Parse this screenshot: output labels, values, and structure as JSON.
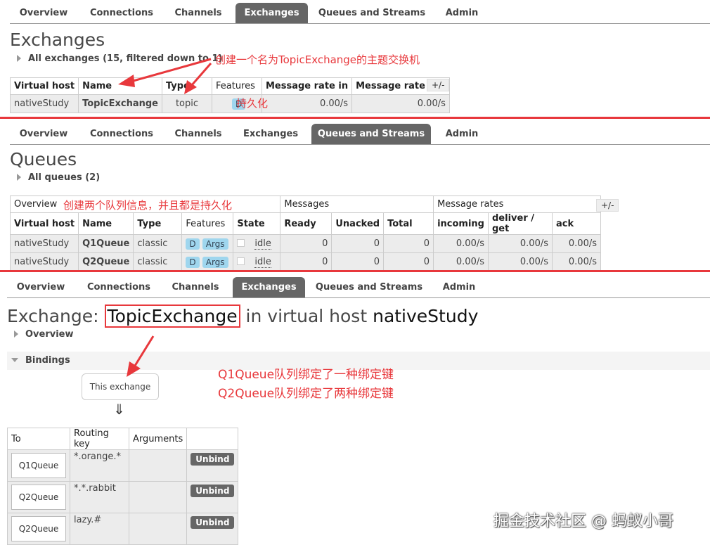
{
  "nav": {
    "tabs": [
      "Overview",
      "Connections",
      "Channels",
      "Exchanges",
      "Queues and Streams",
      "Admin"
    ]
  },
  "section1": {
    "title": "Exchanges",
    "toggle": "All exchanges (15, filtered down to 1)",
    "annotation": "创建一个名为TopicExchange的主题交换机",
    "annotation_durable": "持久化",
    "headers": [
      "Virtual host",
      "Name",
      "Type",
      "Features",
      "Message rate in",
      "Message rate out"
    ],
    "row": {
      "vhost": "nativeStudy",
      "name": "TopicExchange",
      "type": "topic",
      "feature": "D",
      "rate_in": "0.00/s",
      "rate_out": "0.00/s"
    },
    "plusminus": "+/-"
  },
  "section2": {
    "title": "Queues",
    "toggle": "All queues (2)",
    "group_overview": "Overview",
    "annotation": "创建两个队列信息，并且都是持久化",
    "group_messages": "Messages",
    "group_rates": "Message rates",
    "headers": [
      "Virtual host",
      "Name",
      "Type",
      "Features",
      "State",
      "Ready",
      "Unacked",
      "Total",
      "incoming",
      "deliver / get",
      "ack"
    ],
    "rows": [
      {
        "vhost": "nativeStudy",
        "name": "Q1Queue",
        "type": "classic",
        "f1": "D",
        "f2": "Args",
        "state": "idle",
        "ready": "0",
        "unacked": "0",
        "total": "0",
        "incoming": "0.00/s",
        "deliver": "0.00/s",
        "ack": "0.00/s"
      },
      {
        "vhost": "nativeStudy",
        "name": "Q2Queue",
        "type": "classic",
        "f1": "D",
        "f2": "Args",
        "state": "idle",
        "ready": "0",
        "unacked": "0",
        "total": "0",
        "incoming": "0.00/s",
        "deliver": "0.00/s",
        "ack": "0.00/s"
      }
    ],
    "plusminus": "+/-"
  },
  "section3": {
    "title_prefix": "Exchange:",
    "exchange_name": "TopicExchange",
    "title_mid": "in virtual host",
    "vhost": "nativeStudy",
    "overview_toggle": "Overview",
    "bindings_toggle": "Bindings",
    "annotation_line1": "Q1Queue队列绑定了一种绑定键",
    "annotation_line2": "Q2Queue队列绑定了两种绑定键",
    "this_exchange": "This exchange",
    "down_arrow": "⇓",
    "headers": [
      "To",
      "Routing key",
      "Arguments",
      ""
    ],
    "bindings": [
      {
        "to": "Q1Queue",
        "key": "*.orange.*",
        "args": "",
        "action": "Unbind"
      },
      {
        "to": "Q2Queue",
        "key": "*.*.rabbit",
        "args": "",
        "action": "Unbind"
      },
      {
        "to": "Q2Queue",
        "key": "lazy.#",
        "args": "",
        "action": "Unbind"
      }
    ]
  },
  "watermark": "掘金技术社区 @ 蚂蚁小哥",
  "colors": {
    "accent_red": "#e8383c",
    "tab_active": "#666666",
    "badge": "#9fd6ee"
  }
}
